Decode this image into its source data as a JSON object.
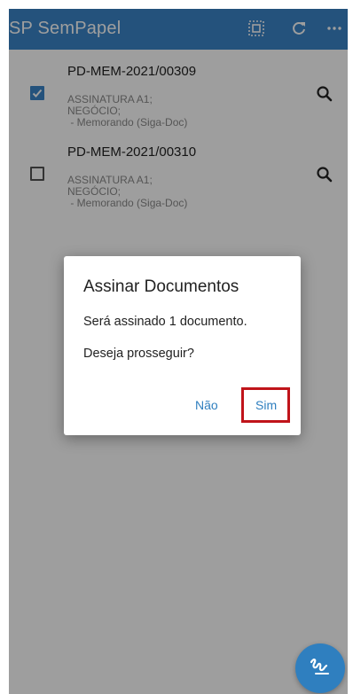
{
  "app": {
    "title": "SP SemPapel",
    "header_icons": [
      "select-all-icon",
      "refresh-icon",
      "more-icon"
    ],
    "accent_color": "#3a85c8"
  },
  "documents": [
    {
      "code": "PD-MEM-2021/00309",
      "detail": "ASSINATURA A1;\nNEGÓCIO;\n - Memorando (Siga-Doc)",
      "checked": true
    },
    {
      "code": "PD-MEM-2021/00310",
      "detail": "ASSINATURA A1;\nNEGÓCIO;\n - Memorando (Siga-Doc)",
      "checked": false
    }
  ],
  "dialog": {
    "title": "Assinar Documentos",
    "message": "Será assinado 1 documento.",
    "question": "Deseja prosseguir?",
    "cancel_label": "Não",
    "confirm_label": "Sim",
    "highlight_color": "#c0141a"
  },
  "fab": {
    "icon": "signature-icon"
  }
}
